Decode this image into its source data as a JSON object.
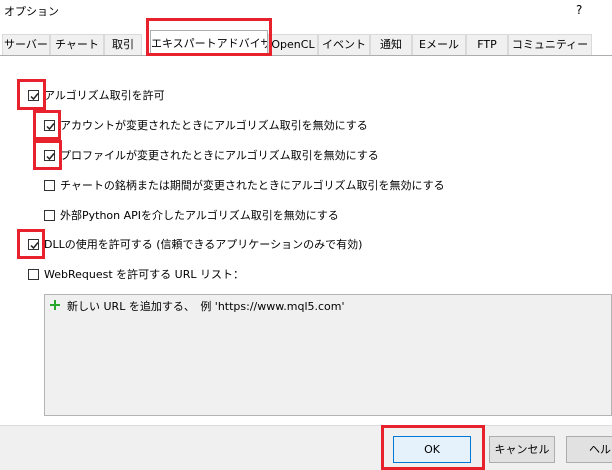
{
  "window": {
    "title": "オプション",
    "help_label": "?"
  },
  "tabs": [
    {
      "label": "サーバー"
    },
    {
      "label": "チャート"
    },
    {
      "label": "取引"
    },
    {
      "label": "エキスパートアドバイザ"
    },
    {
      "label": "OpenCL"
    },
    {
      "label": "イベント"
    },
    {
      "label": "通知"
    },
    {
      "label": "Eメール"
    },
    {
      "label": "FTP"
    },
    {
      "label": "コミュニティー"
    }
  ],
  "active_tab": "エキスパートアドバイザ",
  "options": {
    "algo_trading": {
      "label": "アルゴリズム取引を許可",
      "checked": true
    },
    "disable_on_account_change": {
      "label": "アカウントが変更されたときにアルゴリズム取引を無効にする",
      "checked": true
    },
    "disable_on_profile_change": {
      "label": "プロファイルが変更されたときにアルゴリズム取引を無効にする",
      "checked": true
    },
    "disable_on_symbol_change": {
      "label": "チャートの銘柄または期間が変更されたときにアルゴリズム取引を無効にする",
      "checked": false
    },
    "disable_via_python": {
      "label": "外部Python APIを介したアルゴリズム取引を無効にする",
      "checked": false
    },
    "allow_dll": {
      "label": "DLLの使用を許可する (信頼できるアプリケーションのみで有効)",
      "checked": true
    },
    "webrequest": {
      "label": "WebRequest を許可する URL リスト：",
      "checked": false
    }
  },
  "url_list": {
    "add_text": "新しい URL を追加する、　例 'https://www.mql5.com'"
  },
  "buttons": {
    "ok": "OK",
    "cancel": "キャンセル",
    "help": "ヘルプ"
  },
  "colors": {
    "highlight": "#e8222d",
    "ok_border": "#0078d7",
    "plus": "#2aa72a"
  }
}
